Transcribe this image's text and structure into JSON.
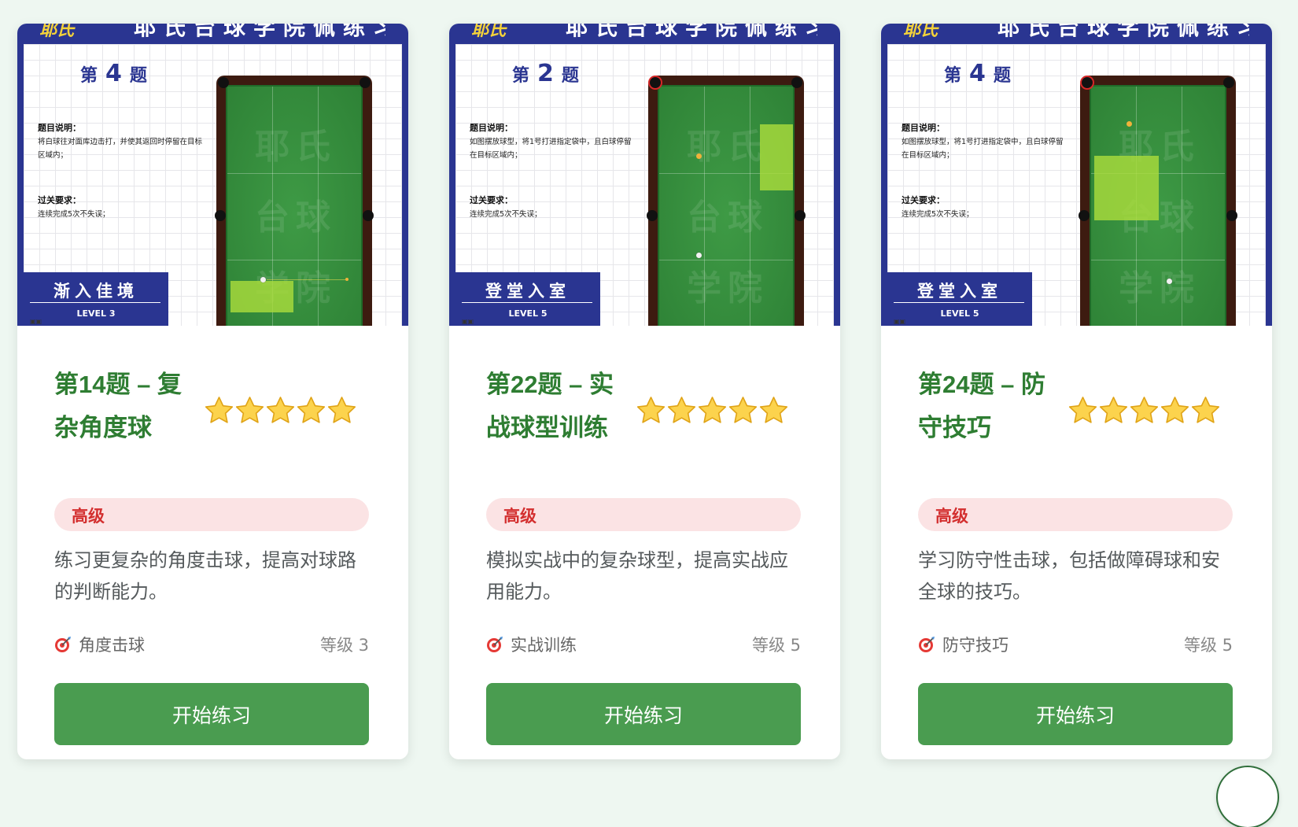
{
  "poster": {
    "header_text": "耶氏台球学院佩练习题",
    "logo_text": "耶氏",
    "q_prefix": "第",
    "q_suffix": "题",
    "desc_title": "题目说明：",
    "req_title": "过关要求：",
    "req_text": "连续完成5次不失误；",
    "watermark": [
      "耶氏",
      "台球",
      "学院"
    ]
  },
  "cards": [
    {
      "poster_q_number": "4",
      "poster_desc": "将白球往对面库边击打，并使其返回时停留在目标区域内；",
      "poster_level_name": "渐入佳境",
      "poster_level_code": "LEVEL 3",
      "title": "第14题 – 复杂角度球",
      "rating": 5,
      "badge": "高级",
      "description": "练习更复杂的角度击球，提高对球路的判断能力。",
      "category": "角度击球",
      "level": "等级 3",
      "button": "开始练习"
    },
    {
      "poster_q_number": "2",
      "poster_desc": "如图摆放球型，将1号打进指定袋中，且白球停留在目标区域内；",
      "poster_level_name": "登堂入室",
      "poster_level_code": "LEVEL 5",
      "title": "第22题 – 实战球型训练",
      "rating": 5,
      "badge": "高级",
      "description": "模拟实战中的复杂球型，提高实战应用能力。",
      "category": "实战训练",
      "level": "等级 5",
      "button": "开始练习"
    },
    {
      "poster_q_number": "4",
      "poster_desc": "如图摆放球型，将1号打进指定袋中，且白球停留在目标区域内；",
      "poster_level_name": "登堂入室",
      "poster_level_code": "LEVEL 5",
      "title": "第24题 – 防守技巧",
      "rating": 5,
      "badge": "高级",
      "description": "学习防守性击球，包括做障碍球和安全球的技巧。",
      "category": "防守技巧",
      "level": "等级 5",
      "button": "开始练习"
    }
  ],
  "colors": {
    "accent_green": "#2e7d32",
    "button_green": "#4a9c50",
    "poster_blue": "#2a3591",
    "badge_red": "#d32f2f",
    "badge_bg": "#fbe3e4"
  },
  "icons": {
    "category": "target-dart-icon",
    "rating": "star-icon"
  }
}
